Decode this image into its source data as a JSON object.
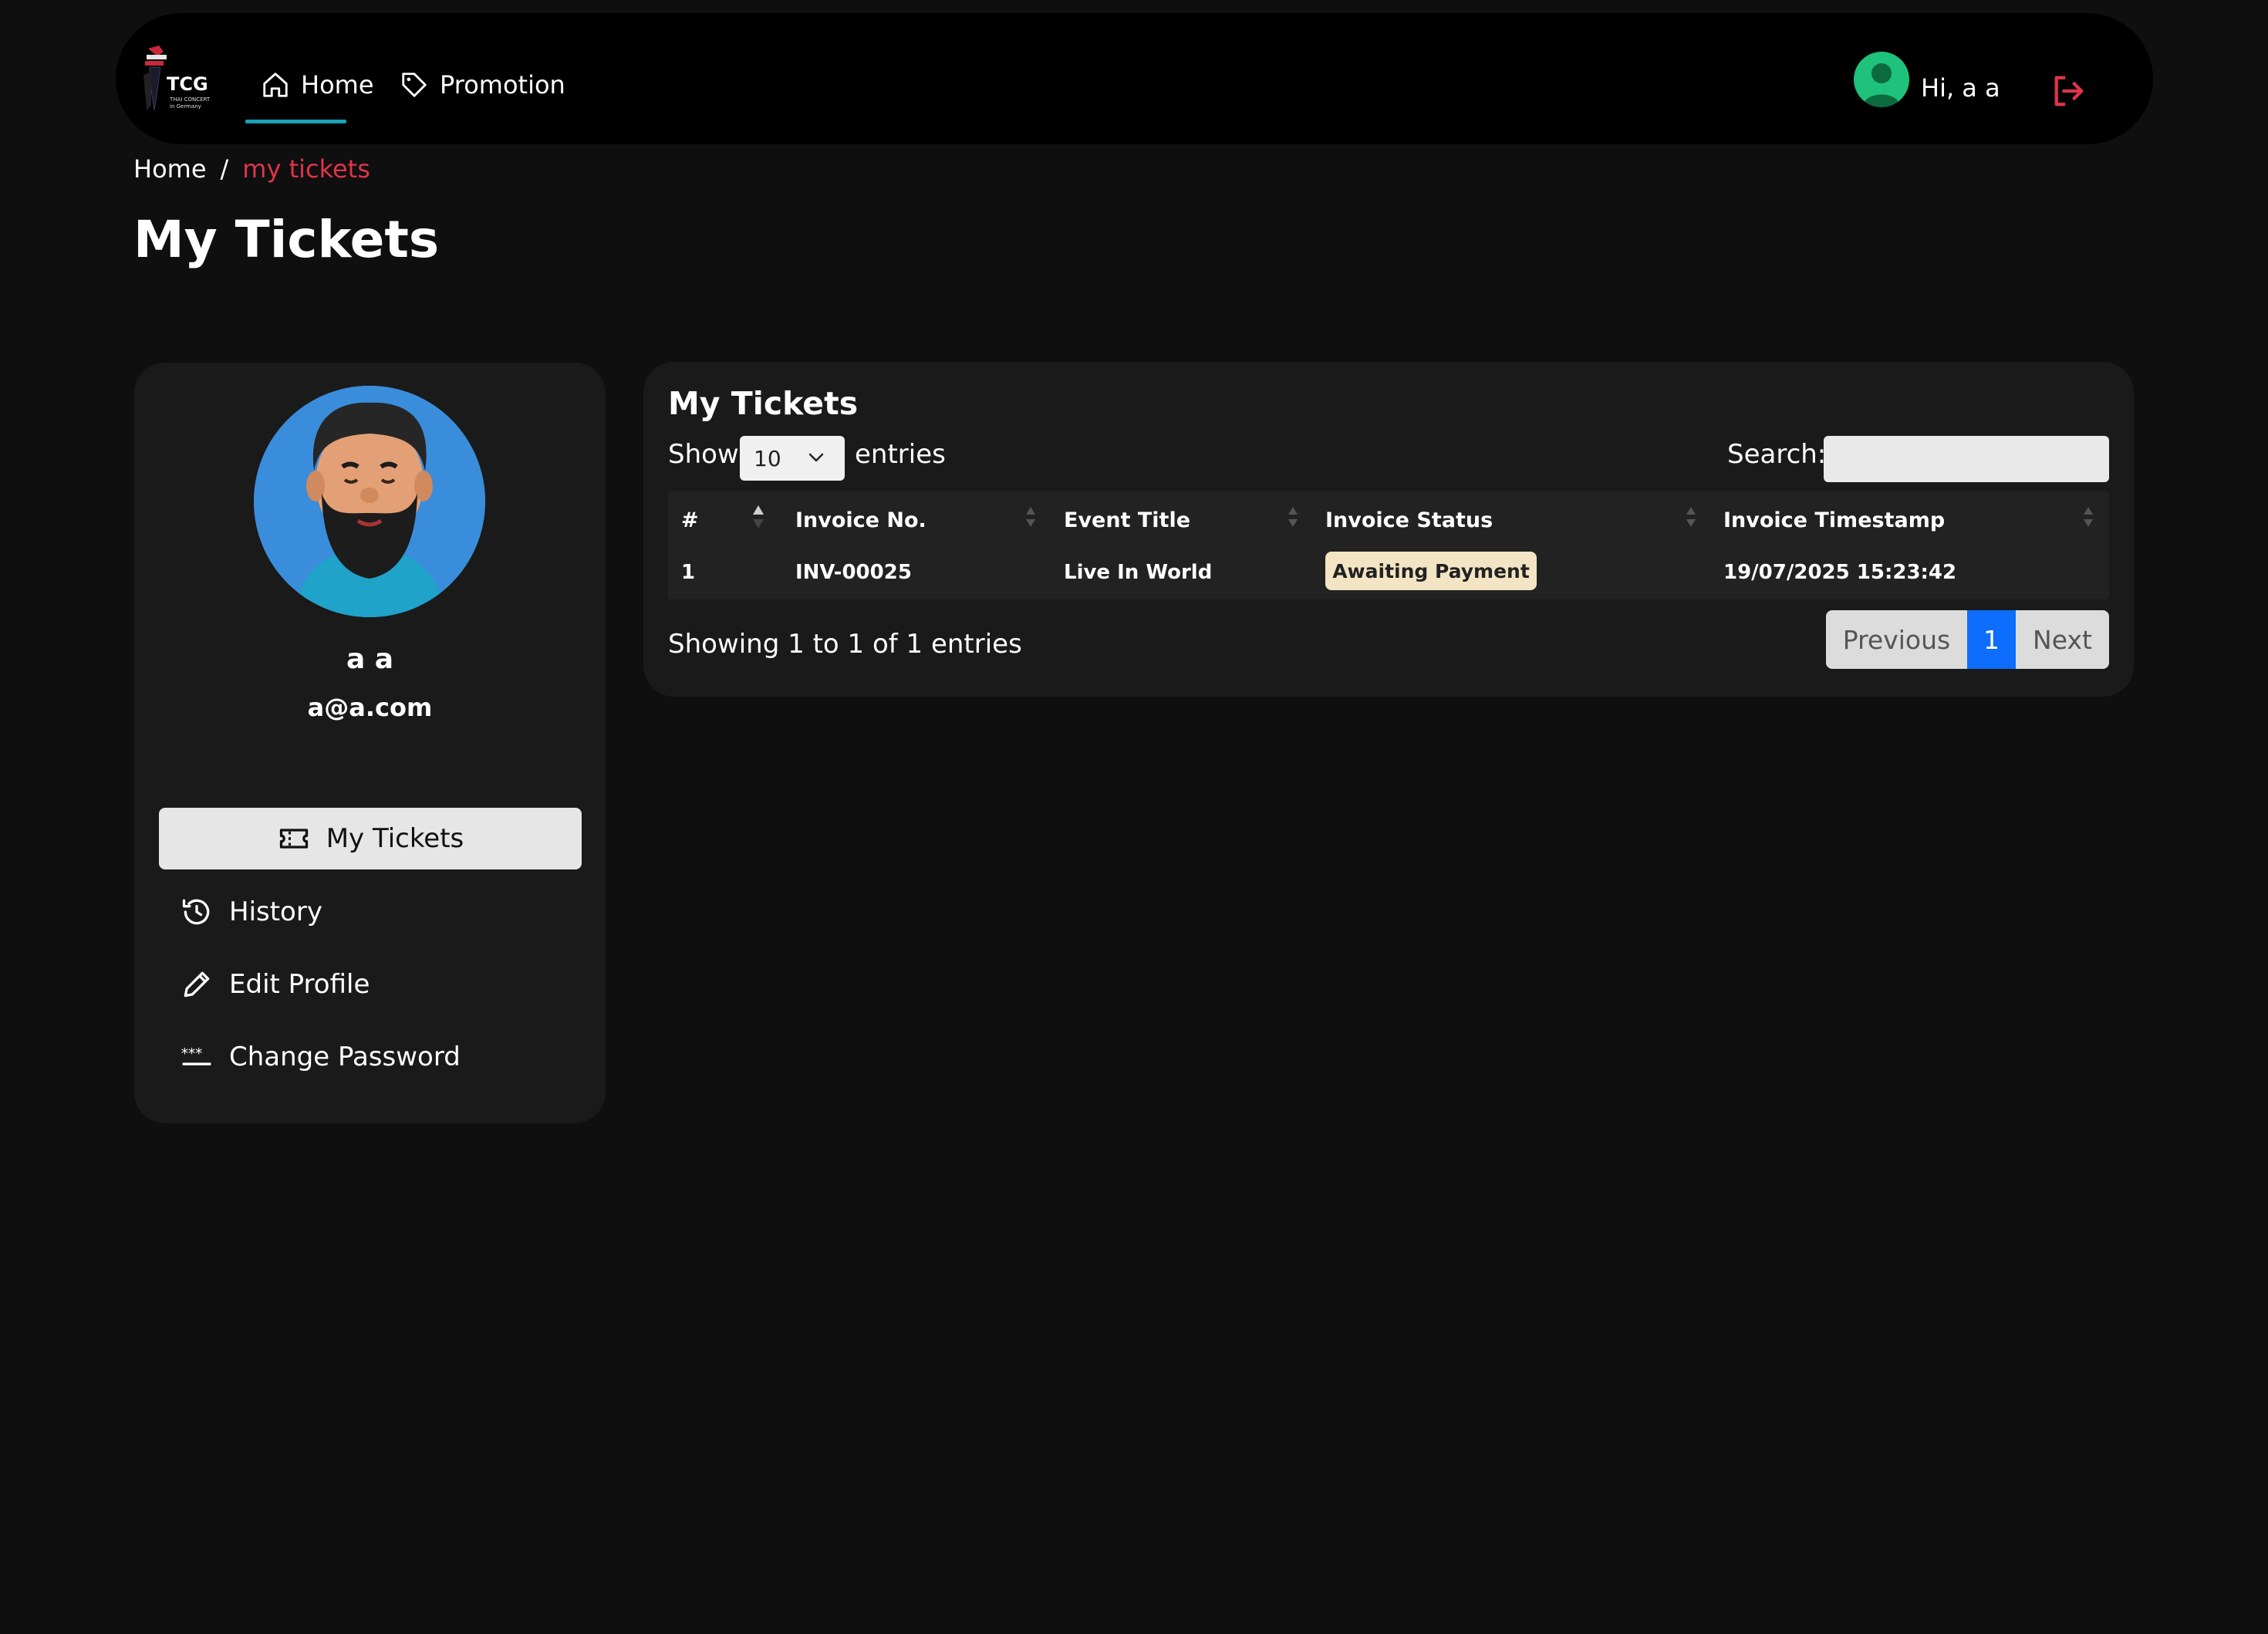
{
  "nav": {
    "brand": "TCG",
    "brand_sub": "THAI CONCERT in Germany",
    "items": [
      {
        "label": "Home",
        "icon": "home-icon",
        "active": true
      },
      {
        "label": "Promotion",
        "icon": "tag-icon",
        "active": false
      }
    ],
    "greeting": "Hi, a a"
  },
  "breadcrumb": {
    "home": "Home",
    "separator": "/",
    "current": "my tickets"
  },
  "page_title": "My Tickets",
  "profile": {
    "name": "a a",
    "email": "a@a.com",
    "menu": [
      {
        "label": "My Tickets",
        "icon": "ticket-icon",
        "active": true
      },
      {
        "label": "History",
        "icon": "history-icon",
        "active": false
      },
      {
        "label": "Edit Profile",
        "icon": "pencil-icon",
        "active": false
      },
      {
        "label": "Change Password",
        "icon": "password-icon",
        "active": false
      }
    ]
  },
  "tickets": {
    "title": "My Tickets",
    "show_label": "Show",
    "page_size": "10",
    "entries_label": "entries",
    "search_label": "Search:",
    "search_value": "",
    "columns": [
      "#",
      "Invoice No.",
      "Event Title",
      "Invoice Status",
      "Invoice Timestamp"
    ],
    "rows": [
      {
        "num": "1",
        "invoice_no": "INV-00025",
        "event_title": "Live In World",
        "status": "Awaiting Payment",
        "timestamp": "19/07/2025 15:23:42"
      }
    ],
    "info": "Showing 1 to 1 of 1 entries",
    "pager": {
      "prev": "Previous",
      "current": "1",
      "next": "Next"
    }
  },
  "colors": {
    "background": "#0f0f0f",
    "accent_red": "#e0344a",
    "nav_underline": "#17a2b8",
    "status_badge": "#f3e5c3",
    "pager_active": "#0d6efd"
  }
}
